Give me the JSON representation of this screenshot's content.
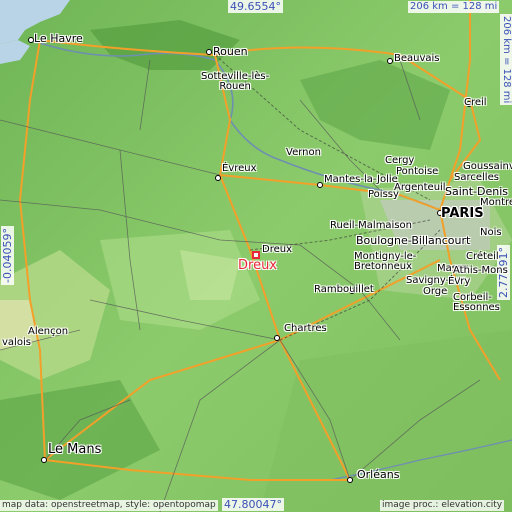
{
  "map": {
    "focus_place": "Dreux",
    "top_coordinate": "49.6554°",
    "bottom_coordinate": "47.80047°",
    "left_coordinate": "-0.04059°",
    "right_coordinate": "2.77191°",
    "scale_horizontal": "206 km = 128 mi",
    "scale_vertical": "206 km = 128 mi",
    "credit_left": "map data: openstreetmap, style: opentopomap",
    "credit_right": "image proc.: elevation.city",
    "colors": {
      "focus": "#e8293a",
      "coordinate_text": "#3b50b8",
      "lowland": "#9bd37a",
      "upland": "#4f9a3c",
      "sea": "#b8d4e6",
      "motorway": "#f2a02a"
    }
  },
  "places": [
    {
      "id": "le-havre",
      "name": "Le Havre"
    },
    {
      "id": "rouen",
      "name": "Rouen"
    },
    {
      "id": "sotteville",
      "name": "Sotteville-lès-\nRouen"
    },
    {
      "id": "beauvais",
      "name": "Beauvais"
    },
    {
      "id": "creil",
      "name": "Creil"
    },
    {
      "id": "paris",
      "name": "PARIS"
    },
    {
      "id": "vernon",
      "name": "Vernon"
    },
    {
      "id": "evreux",
      "name": "Évreux"
    },
    {
      "id": "mantes",
      "name": "Mantes-la-Jolie"
    },
    {
      "id": "cergy",
      "name": "Cergy"
    },
    {
      "id": "pontoise",
      "name": "Pontoise"
    },
    {
      "id": "sarcelles",
      "name": "Sarcelles"
    },
    {
      "id": "goussainville",
      "name": "Goussainville"
    },
    {
      "id": "argenteuil",
      "name": "Argenteuil"
    },
    {
      "id": "poissy",
      "name": "Poissy"
    },
    {
      "id": "saint-denis",
      "name": "Saint-Denis"
    },
    {
      "id": "montreuil",
      "name": "Montre"
    },
    {
      "id": "rueil",
      "name": "Rueil-Malmaison"
    },
    {
      "id": "boulogne",
      "name": "Boulogne-Billancourt"
    },
    {
      "id": "noisy",
      "name": "Nois"
    },
    {
      "id": "dreux",
      "name": "Dreux"
    },
    {
      "id": "montigny",
      "name": "Montigny-le-\nBretonneux"
    },
    {
      "id": "creteil",
      "name": "Créteil"
    },
    {
      "id": "massy",
      "name": "Massy"
    },
    {
      "id": "athis",
      "name": "Athis-Mons"
    },
    {
      "id": "savigny",
      "name": "Savigny-sur-"
    },
    {
      "id": "orge",
      "name": "Orge"
    },
    {
      "id": "evry",
      "name": "Évry"
    },
    {
      "id": "corbeil",
      "name": "Corbeil-\nEssonnes"
    },
    {
      "id": "rambouillet",
      "name": "Rambouillet"
    },
    {
      "id": "chartres",
      "name": "Chartres"
    },
    {
      "id": "alencon",
      "name": "Alençon"
    },
    {
      "id": "valois",
      "name": "valois"
    },
    {
      "id": "le-mans",
      "name": "Le Mans"
    },
    {
      "id": "orleans",
      "name": "Orléans"
    }
  ]
}
